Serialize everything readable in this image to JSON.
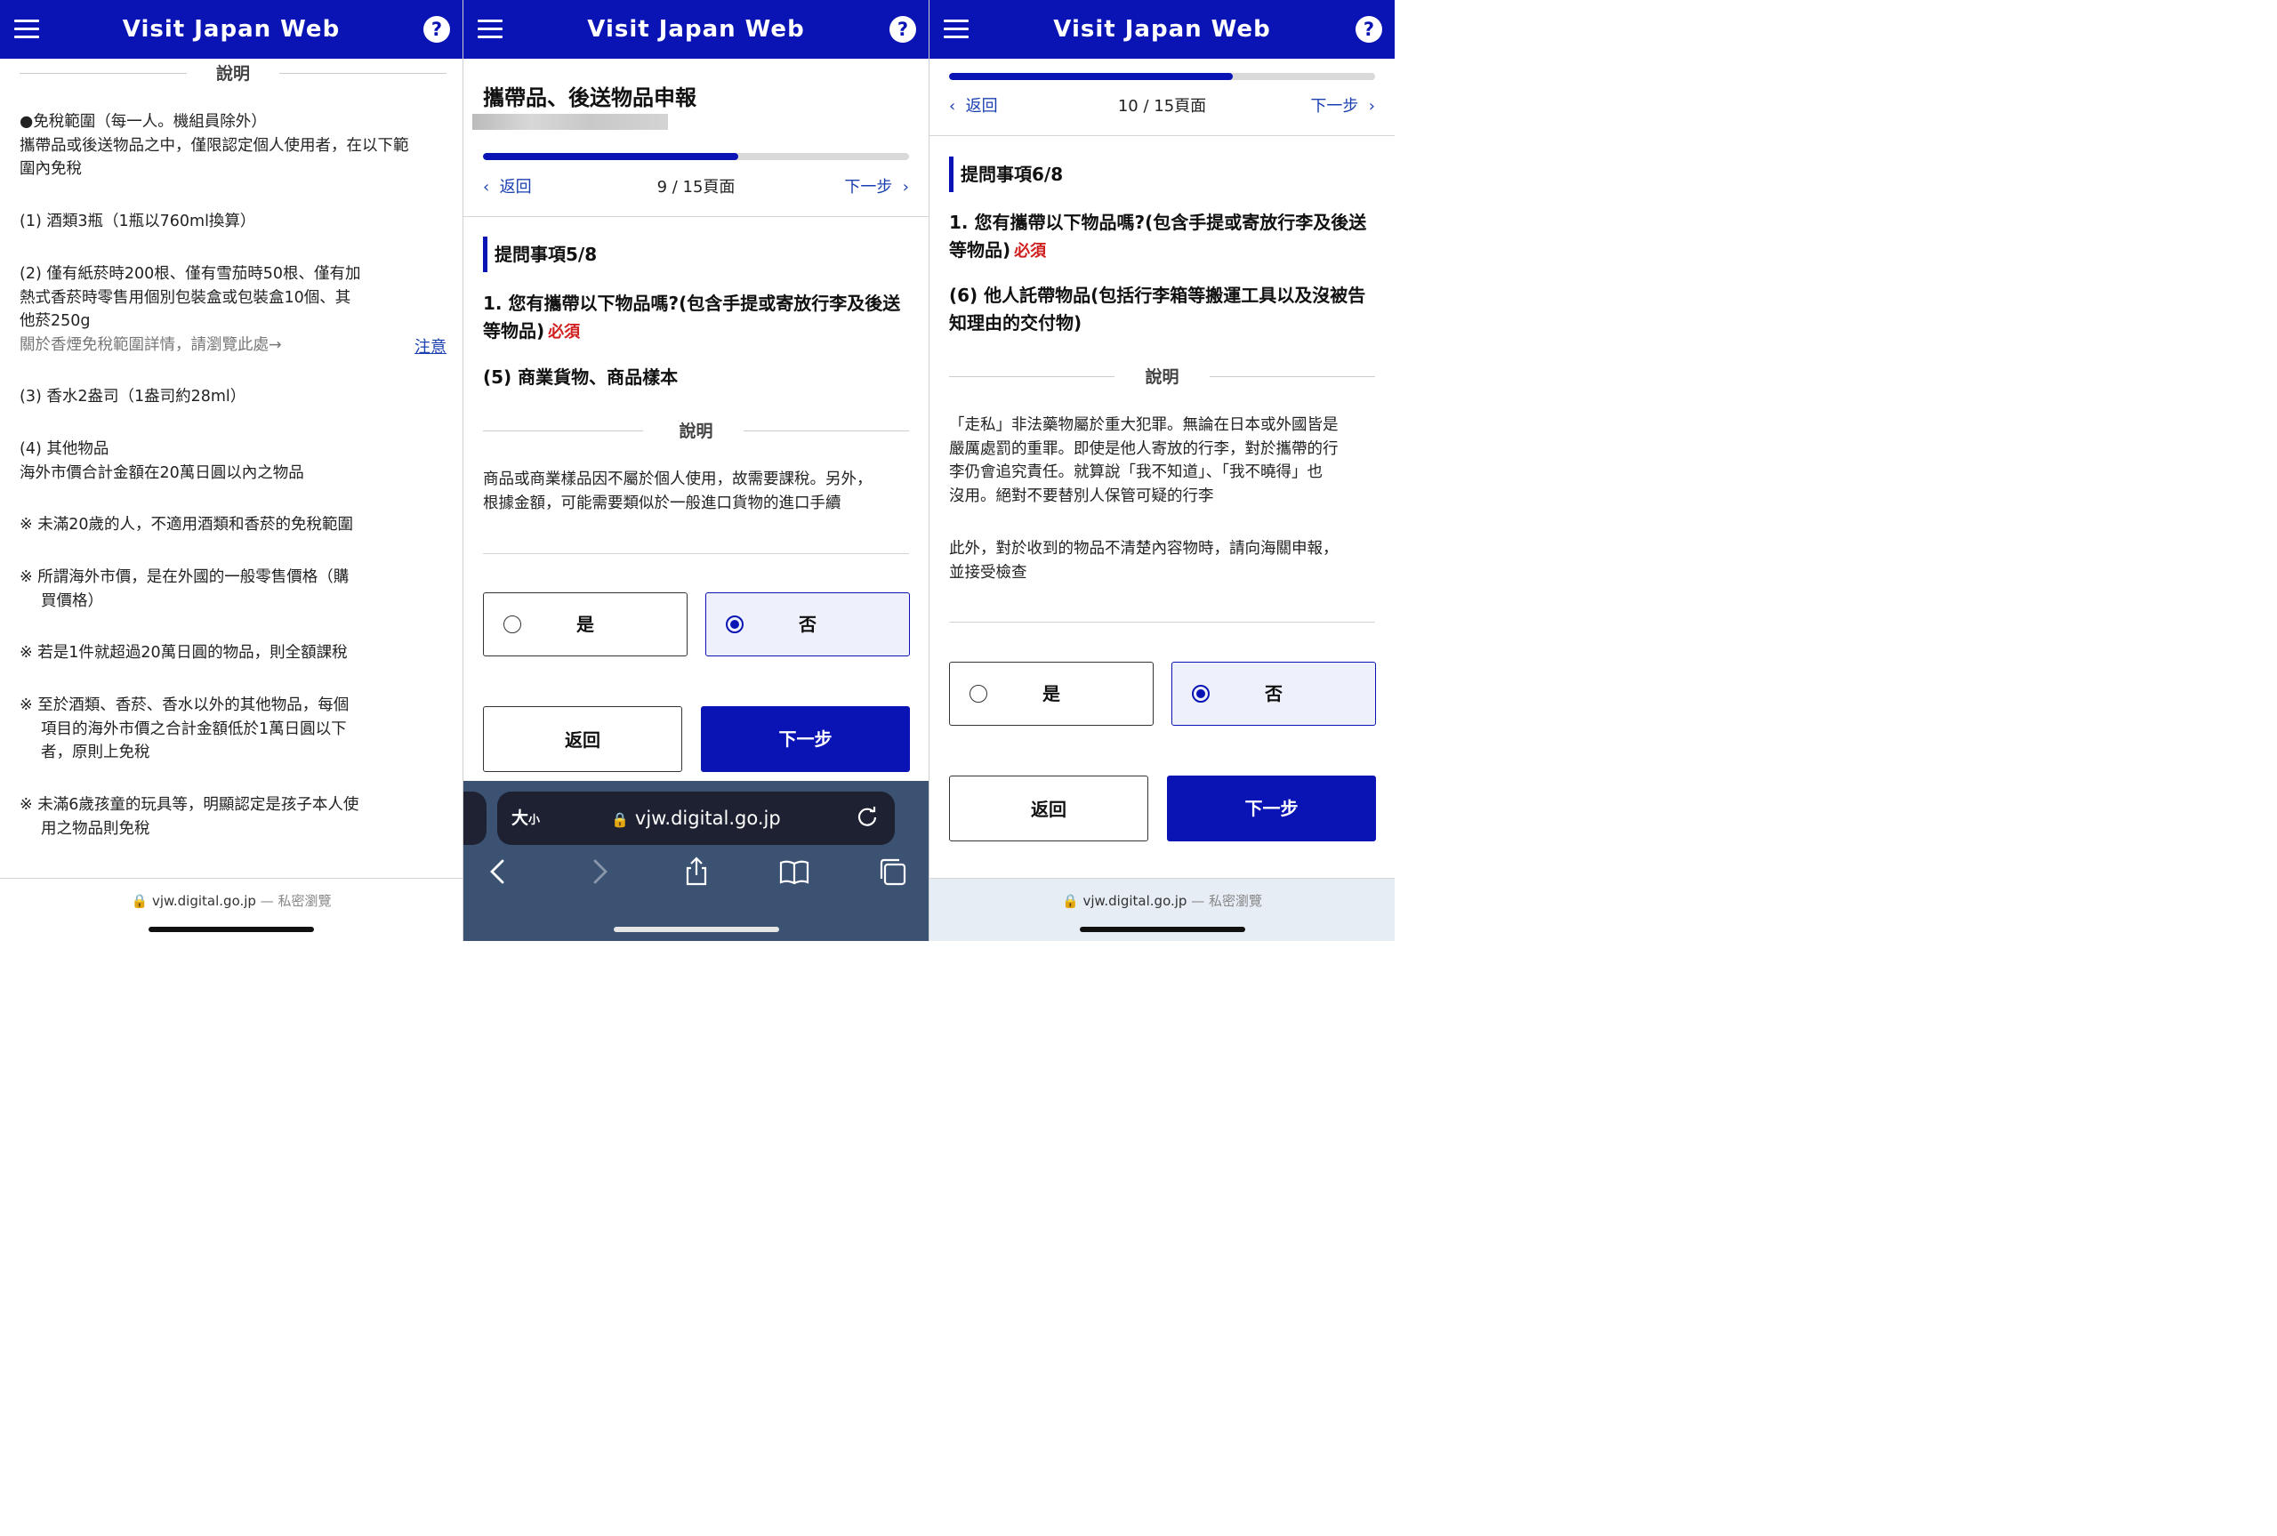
{
  "header": {
    "title": "Visit Japan Web",
    "help_label": "?"
  },
  "panel1": {
    "section_title": "說明",
    "blocks": [
      "●免稅範圍（每一人。機組員除外）",
      "攜帶品或後送物品之中，僅限認定個人使用者，在以下範",
      "圍內免稅",
      "(1) 酒類3瓶（1瓶以760ml換算）",
      "(2) 僅有紙菸時200根、僅有雪茄時50根、僅有加",
      "熱式香菸時零售用個別包裝盒或包裝盒10個、其",
      "他菸250g",
      "關於香煙免稅範圍詳情，請瀏覽此處→",
      "(3) 香水2盎司（1盎司約28ml）",
      "(4) 其他物品",
      "海外市價合計金額在20萬日圓以內之物品",
      "※ 未滿20歲的人，不適用酒類和香菸的免稅範圍",
      "※ 所謂海外市價，是在外國的一般零售價格（購",
      "買價格）",
      "※ 若是1件就超過20萬日圓的物品，則全額課稅",
      "※ 至於酒類、香菸、香水以外的其他物品，每個",
      "項目的海外市價之合計金額低於1萬日圓以下",
      "者，原則上免稅",
      "※ 未滿6歲孩童的玩具等，明顯認定是孩子本人使",
      "用之物品則免稅"
    ],
    "note_link": "注意",
    "footer_url": "vjw.digital.go.jp",
    "footer_private": "— 私密瀏覽"
  },
  "panel2": {
    "page_title": "攜帶品、後送物品申報",
    "progress": 0.6,
    "nav_back": "返回",
    "nav_page": "9 / 15頁面",
    "nav_next": "下一步",
    "question_head": "提問事項5/8",
    "question": "1. 您有攜帶以下物品嗎?(包含手提或寄放行李及後送等物品)",
    "required": "必須",
    "item": "(5) 商業貨物、商品樣本",
    "section_title": "說明",
    "explain": [
      "商品或商業樣品因不屬於個人使用，故需要課稅。另外，",
      "根據金額，可能需要類似於一般進口貨物的進口手續"
    ],
    "option_yes": "是",
    "option_no": "否",
    "selected": "no",
    "btn_back": "返回",
    "btn_next": "下一步",
    "safari": {
      "text_size": "大",
      "text_size_small": "小",
      "url": "vjw.digital.go.jp"
    }
  },
  "panel3": {
    "progress": 0.6667,
    "nav_back": "返回",
    "nav_page": "10 / 15頁面",
    "nav_next": "下一步",
    "question_head": "提問事項6/8",
    "question": "1. 您有攜帶以下物品嗎?(包含手提或寄放行李及後送等物品)",
    "required": "必須",
    "item": "(6) 他人託帶物品(包括行李箱等搬運工具以及沒被告知理由的交付物)",
    "section_title": "說明",
    "explain1": [
      "「走私」非法藥物屬於重大犯罪。無論在日本或外國皆是",
      "嚴厲處罰的重罪。即使是他人寄放的行李，對於攜帶的行",
      "李仍會追究責任。就算說「我不知道」、「我不曉得」也",
      "沒用。絕對不要替別人保管可疑的行李"
    ],
    "explain2": [
      "此外，對於收到的物品不清楚內容物時，請向海關申報，",
      "並接受檢查"
    ],
    "option_yes": "是",
    "option_no": "否",
    "selected": "no",
    "btn_back": "返回",
    "btn_next": "下一步",
    "footer_url": "vjw.digital.go.jp",
    "footer_private": "— 私密瀏覽"
  }
}
